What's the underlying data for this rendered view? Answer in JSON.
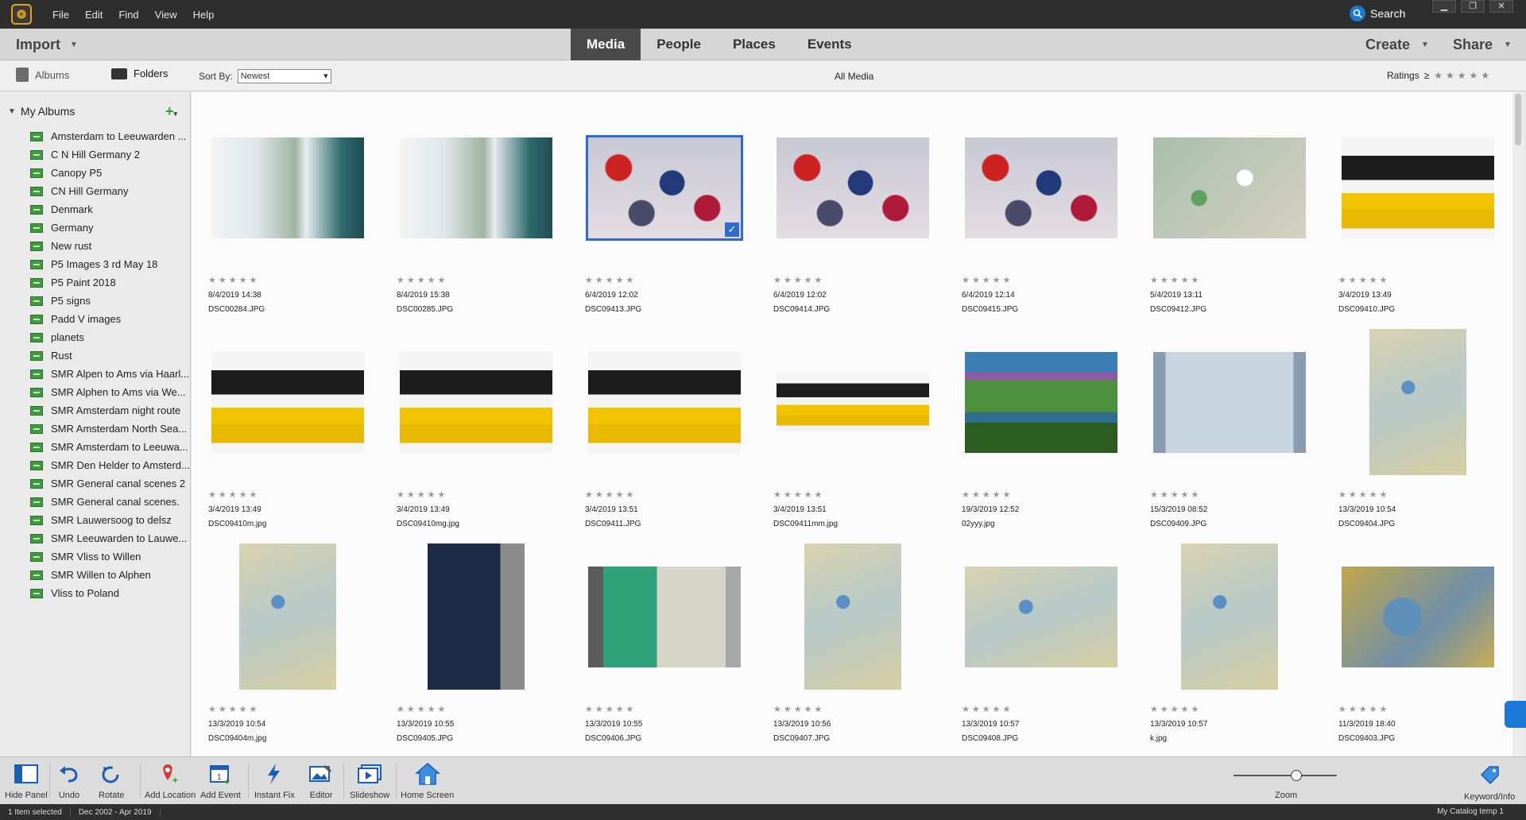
{
  "menu": [
    "File",
    "Edit",
    "Find",
    "View",
    "Help"
  ],
  "search_label": "Search",
  "nav": {
    "import": "Import",
    "tabs": [
      "Media",
      "People",
      "Places",
      "Events"
    ],
    "active_tab": "Media",
    "create": "Create",
    "share": "Share"
  },
  "subbar": {
    "albums_tab": "Albums",
    "folders_tab": "Folders",
    "sort_label": "Sort By:",
    "sort_value": "Newest",
    "view_title": "All Media",
    "ratings_label": "Ratings",
    "ratings_op": "≥"
  },
  "sidebar": {
    "section": "My Albums",
    "albums": [
      "Amsterdam to Leeuwarden ...",
      "C N Hill Germany 2",
      "Canopy P5",
      "CN Hill Germany",
      "Denmark",
      "Germany",
      "New rust",
      "P5 Images 3 rd May 18",
      "P5 Paint 2018",
      "P5 signs",
      "Padd V images",
      "planets",
      "Rust",
      "SMR Alpen to Ams via Haarl...",
      "SMR Alphen to Ams via We...",
      "SMR Amsterdam night route",
      "SMR Amsterdam North Sea...",
      "SMR Amsterdam to Leeuwa...",
      "SMR Den Helder to Amsterd...",
      "SMR General canal scenes 2",
      "SMR General canal scenes.",
      "SMR Lauwersoog to delsz",
      "SMR Leeuwarden to Lauwe...",
      "SMR Vliss to Willen",
      "SMR Willen to Alphen",
      "Vliss to Poland"
    ]
  },
  "media": [
    {
      "date": "8/4/2019 14:38",
      "file": "DSC00284.JPG",
      "kind": "window",
      "orient": "land"
    },
    {
      "date": "8/4/2019 15:38",
      "file": "DSC00285.JPG",
      "kind": "window",
      "orient": "land"
    },
    {
      "date": "6/4/2019 12:02",
      "file": "DSC09413.JPG",
      "kind": "clothes",
      "orient": "land",
      "selected": true
    },
    {
      "date": "6/4/2019 12:02",
      "file": "DSC09414.JPG",
      "kind": "clothes",
      "orient": "land"
    },
    {
      "date": "6/4/2019 12:14",
      "file": "DSC09415.JPG",
      "kind": "clothes",
      "orient": "land"
    },
    {
      "date": "5/4/2019 13:11",
      "file": "DSC09412.JPG",
      "kind": "table",
      "orient": "land"
    },
    {
      "date": "3/4/2019 13:49",
      "file": "DSC09410.JPG",
      "kind": "knife",
      "orient": "land"
    },
    {
      "date": "3/4/2019 13:49",
      "file": "DSC09410m.jpg",
      "kind": "knife",
      "orient": "land"
    },
    {
      "date": "3/4/2019 13:49",
      "file": "DSC09410mg.jpg",
      "kind": "knife",
      "orient": "land"
    },
    {
      "date": "3/4/2019 13:51",
      "file": "DSC09411.JPG",
      "kind": "knife",
      "orient": "land"
    },
    {
      "date": "3/4/2019 13:51",
      "file": "DSC09411mm.jpg",
      "kind": "knife",
      "orient": "wide"
    },
    {
      "date": "19/3/2019 12:52",
      "file": "02yyy.jpg",
      "kind": "aerial",
      "orient": "land"
    },
    {
      "date": "15/3/2019 08:52",
      "file": "DSC09409.JPG",
      "kind": "book",
      "orient": "land"
    },
    {
      "date": "13/3/2019 10:54",
      "file": "DSC09404.JPG",
      "kind": "map",
      "orient": "port"
    },
    {
      "date": "13/3/2019 10:54",
      "file": "DSC09404m.jpg",
      "kind": "map",
      "orient": "port"
    },
    {
      "date": "13/3/2019 10:55",
      "file": "DSC09405.JPG",
      "kind": "darkbook",
      "orient": "port"
    },
    {
      "date": "13/3/2019 10:55",
      "file": "DSC09406.JPG",
      "kind": "greenbook",
      "orient": "land"
    },
    {
      "date": "13/3/2019 10:56",
      "file": "DSC09407.JPG",
      "kind": "map",
      "orient": "port"
    },
    {
      "date": "13/3/2019 10:57",
      "file": "DSC09408.JPG",
      "kind": "map",
      "orient": "land"
    },
    {
      "date": "13/3/2019 10:57",
      "file": "k.jpg",
      "kind": "map",
      "orient": "port"
    },
    {
      "date": "11/3/2019 18:40",
      "file": "DSC09403.JPG",
      "kind": "seamap",
      "orient": "land"
    }
  ],
  "toolbar": {
    "tools": [
      "Hide Panel",
      "Undo",
      "Rotate",
      "Add Location",
      "Add Event",
      "Instant Fix",
      "Editor",
      "Slideshow",
      "Home Screen"
    ],
    "zoom_label": "Zoom",
    "zoom_level": 0.62,
    "keyword": "Keyword/Info"
  },
  "status": {
    "selected": "1 Item selected",
    "range": "Dec 2002 - Apr 2019",
    "catalog": "My Catalog temp 1"
  },
  "colors": {
    "accent": "#2f6cd0",
    "album_icon": "#3f9a3f"
  }
}
